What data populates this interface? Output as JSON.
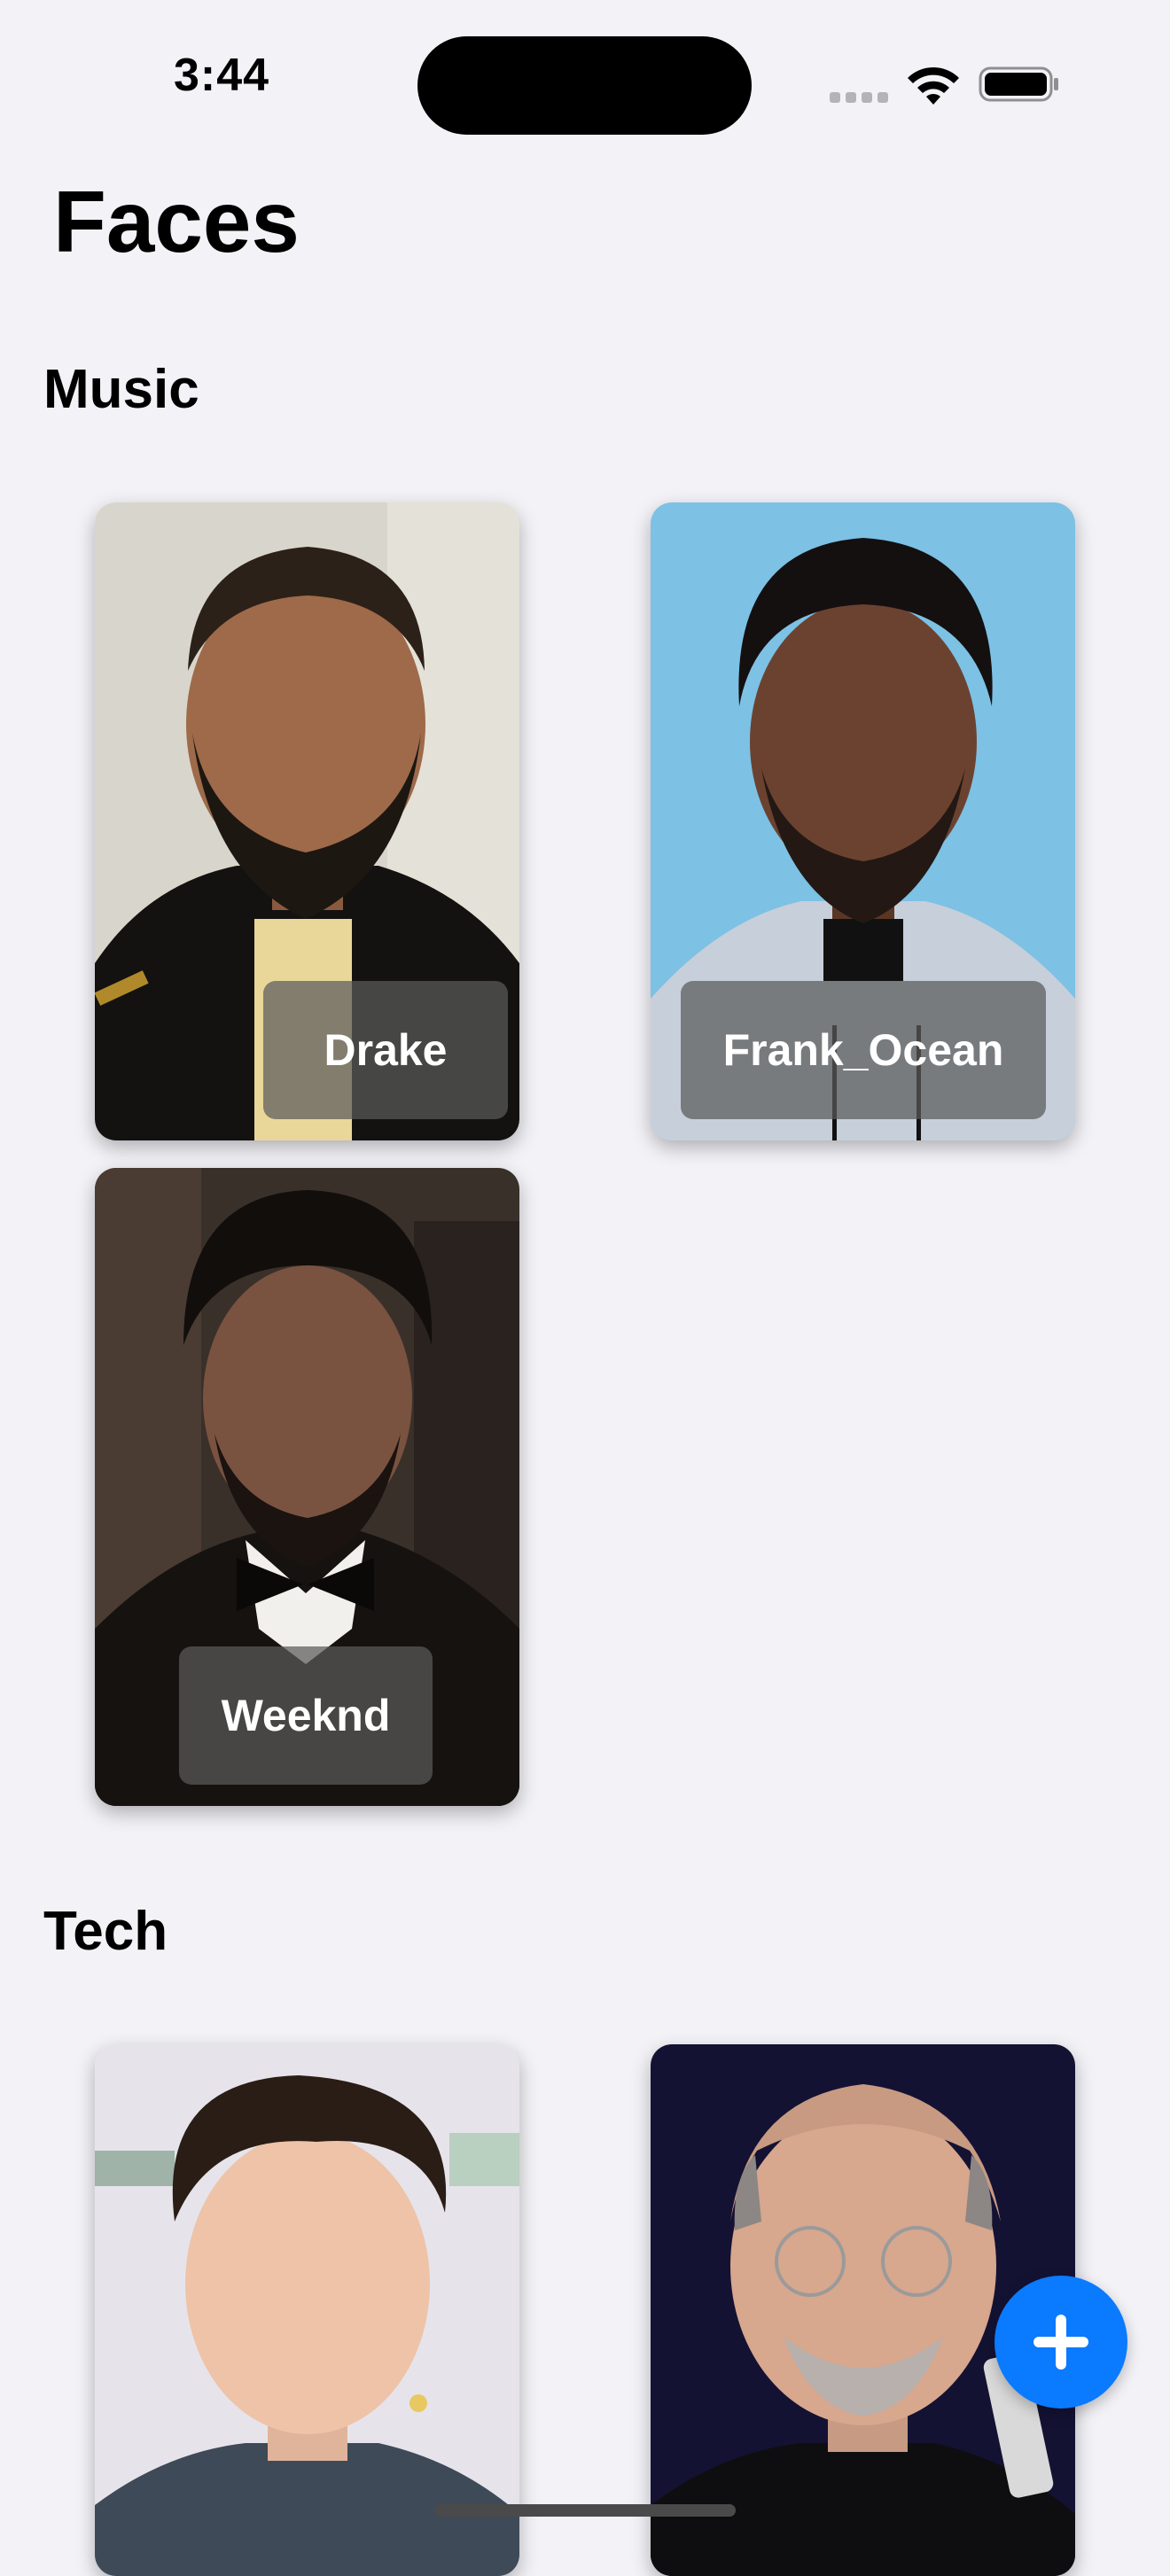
{
  "status_bar": {
    "time": "3:44"
  },
  "header": {
    "title": "Faces"
  },
  "sections": [
    {
      "title": "Music",
      "people": [
        {
          "name": "Drake"
        },
        {
          "name": "Frank_Ocean"
        },
        {
          "name": "Weeknd"
        }
      ]
    },
    {
      "title": "Tech",
      "people": [
        {
          "name": ""
        },
        {
          "name": ""
        }
      ]
    }
  ],
  "fab": {
    "icon": "plus-icon"
  },
  "colors": {
    "background": "#F2F2F7",
    "accent": "#0A7AFF"
  }
}
